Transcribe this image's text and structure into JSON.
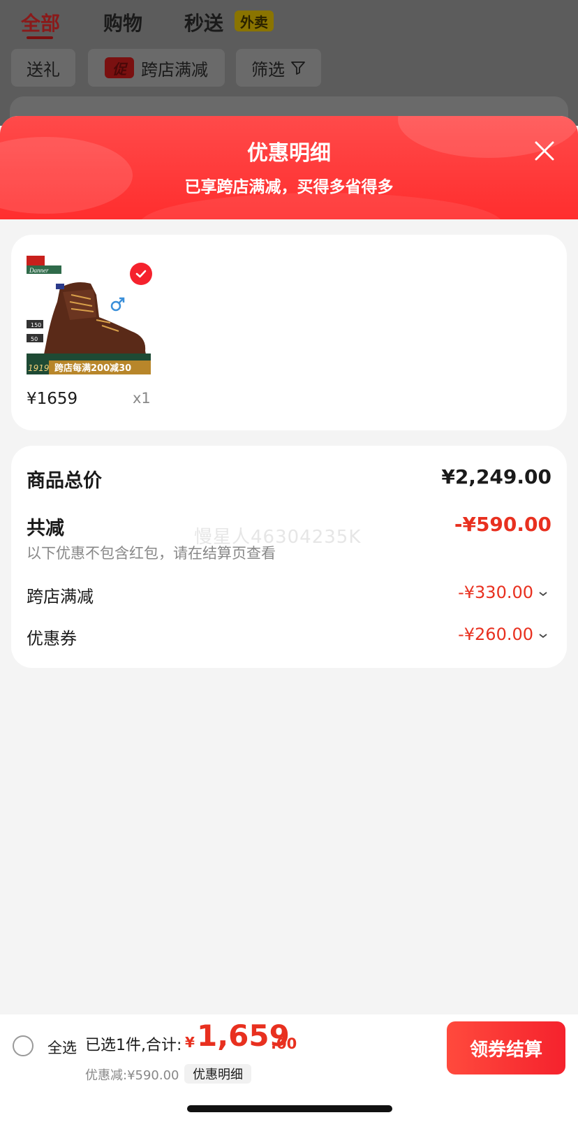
{
  "top_tabs": {
    "all": "全部",
    "shopping": "购物",
    "flash": "秒送",
    "flash_badge": "外卖"
  },
  "filters": {
    "gift": "送礼",
    "promo_tag": "促",
    "cross_store": "跨店满减",
    "filter": "筛选"
  },
  "sheet": {
    "title": "优惠明细",
    "subtitle": "已享跨店满减，买得多省得多"
  },
  "product": {
    "price": "¥1659",
    "qty": "x1",
    "image_labels": {
      "brand": "Danner",
      "year": "1919",
      "promo_banner": "跨店每满200减30",
      "tag1": "150",
      "tag2": "50"
    }
  },
  "summary": {
    "total_label": "商品总价",
    "total_value": "¥2,249.00",
    "reduce_label": "共减",
    "reduce_value": "-¥590.00",
    "note": "以下优惠不包含红包，请在结算页查看",
    "watermark": "慢星人46304235K",
    "items": [
      {
        "label": "跨店满减",
        "value": "-¥330.00"
      },
      {
        "label": "优惠券",
        "value": "-¥260.00"
      }
    ]
  },
  "bottom": {
    "select_all": "全选",
    "selected": "已选1件,合计:",
    "currency": "¥",
    "total_int": "1,659",
    "total_dec": ".00",
    "discount": "优惠减:¥590.00",
    "detail_chip": "优惠明细",
    "checkout": "领券结算"
  },
  "colors": {
    "accent_red": "#f5222d",
    "price_red": "#e8301f"
  }
}
